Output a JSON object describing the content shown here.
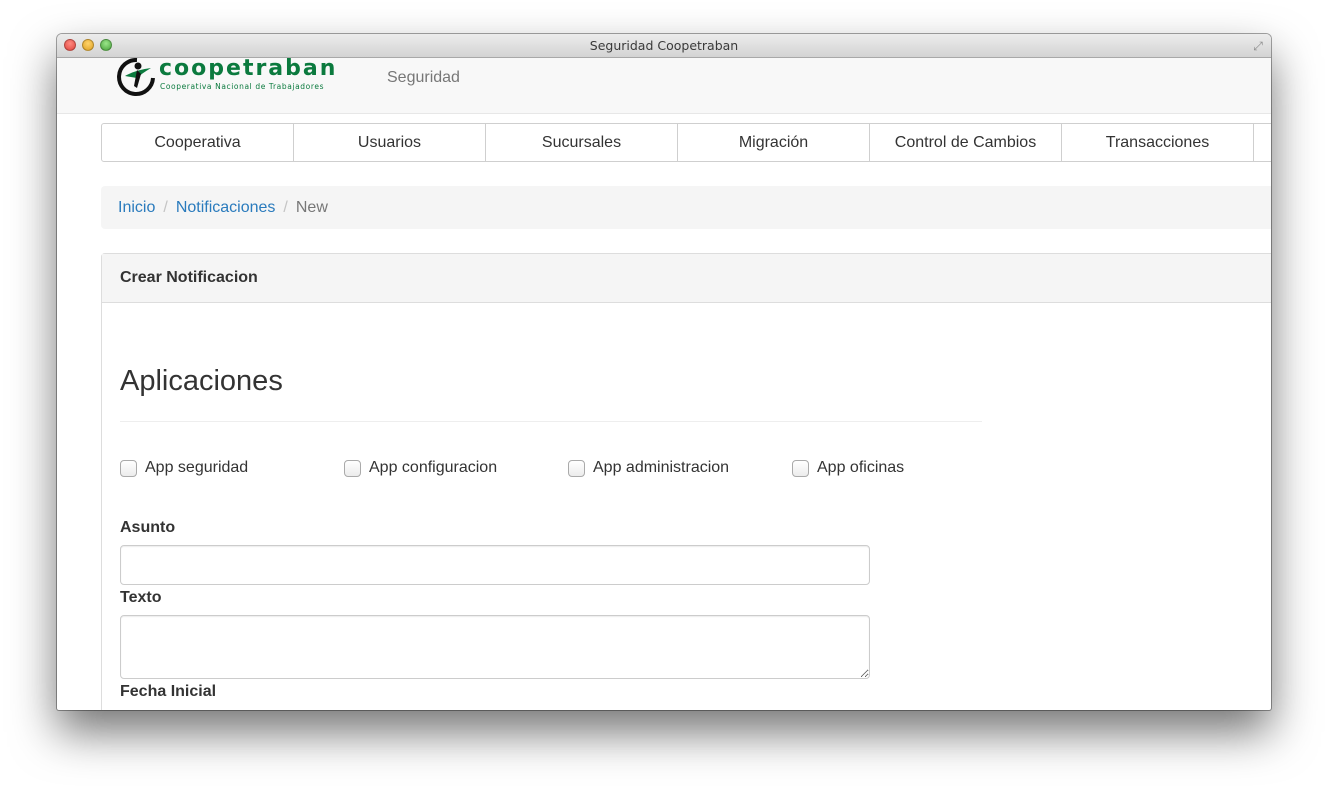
{
  "window": {
    "title": "Seguridad Coopetraban"
  },
  "navbar": {
    "logo_word": "coopetraban",
    "logo_subtitle": "Cooperativa Nacional de Trabajadores",
    "brand": "Seguridad"
  },
  "menu": {
    "items": [
      {
        "label": "Cooperativa"
      },
      {
        "label": "Usuarios"
      },
      {
        "label": "Sucursales"
      },
      {
        "label": "Migración"
      },
      {
        "label": "Control de Cambios"
      },
      {
        "label": "Transacciones"
      }
    ]
  },
  "breadcrumb": {
    "items": [
      {
        "label": "Inicio"
      },
      {
        "label": "Notificaciones"
      }
    ],
    "active": "New",
    "separator": "/"
  },
  "panel": {
    "heading": "Crear Notificacion",
    "section_title": "Aplicaciones",
    "checkboxes": [
      {
        "label": "App seguridad",
        "checked": false
      },
      {
        "label": "App configuracion",
        "checked": false
      },
      {
        "label": "App administracion",
        "checked": false
      },
      {
        "label": "App oficinas",
        "checked": false
      }
    ],
    "fields": {
      "asunto_label": "Asunto",
      "asunto_value": "",
      "texto_label": "Texto",
      "texto_value": "",
      "fecha_inicial_label": "Fecha Inicial"
    }
  },
  "colors": {
    "brand_green": "#0b7a3e",
    "link_blue": "#2a7bbd",
    "muted_gray": "#777777"
  }
}
